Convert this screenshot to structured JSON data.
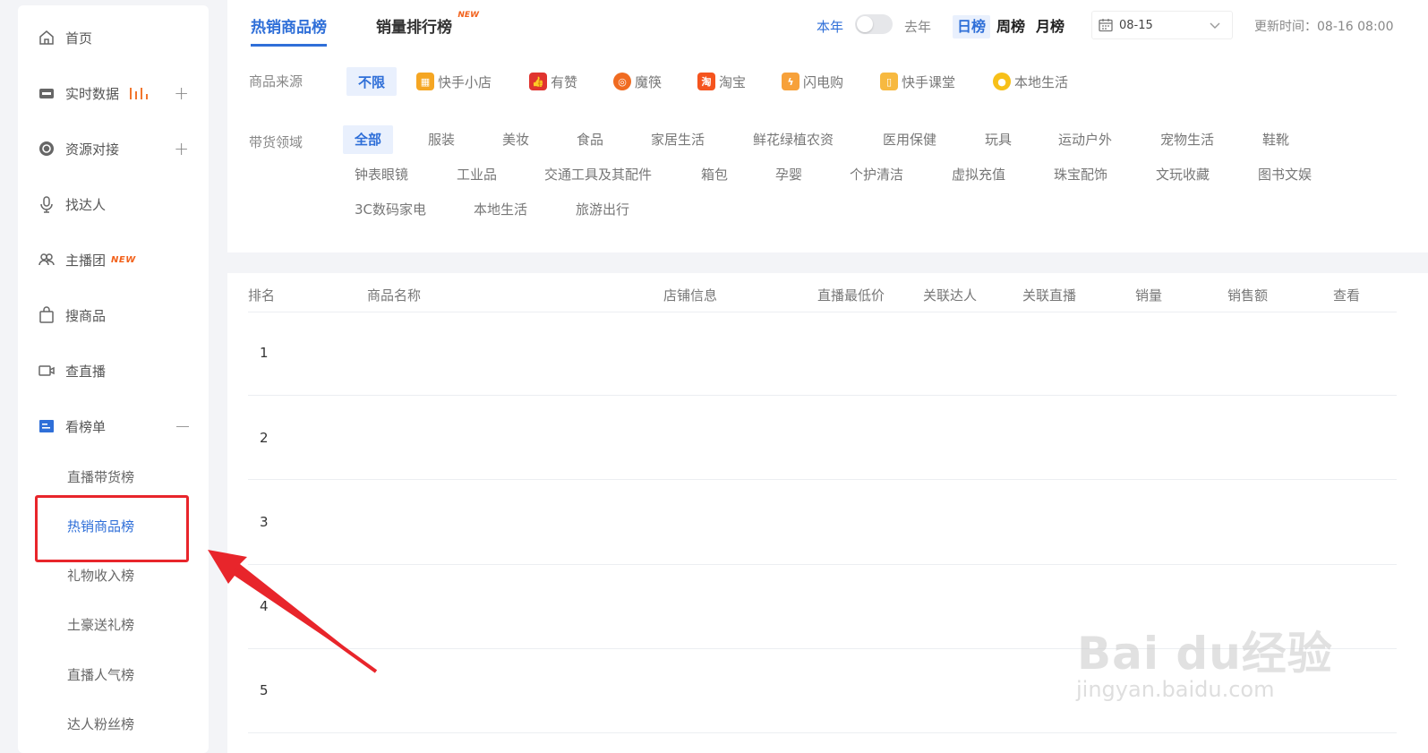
{
  "sidebar": {
    "items": [
      {
        "label": "首页"
      },
      {
        "label": "实时数据"
      },
      {
        "label": "资源对接"
      },
      {
        "label": "找达人"
      },
      {
        "label": "主播团",
        "badge": "NEW"
      },
      {
        "label": "搜商品"
      },
      {
        "label": "查直播"
      },
      {
        "label": "看榜单"
      }
    ],
    "sub_items": [
      {
        "label": "直播带货榜"
      },
      {
        "label": "热销商品榜"
      },
      {
        "label": "礼物收入榜"
      },
      {
        "label": "土豪送礼榜"
      },
      {
        "label": "直播人气榜"
      },
      {
        "label": "达人粉丝榜"
      }
    ]
  },
  "header": {
    "tabs": [
      {
        "label": "热销商品榜"
      },
      {
        "label": "销量排行榜",
        "badge": "NEW"
      }
    ],
    "year_this": "本年",
    "year_last": "去年",
    "periods": [
      "日榜",
      "周榜",
      "月榜"
    ],
    "date": "08-15",
    "update_time": "更新时间：08-16 08:00"
  },
  "filters": {
    "source_label": "商品来源",
    "sources": [
      {
        "label": "不限",
        "color": ""
      },
      {
        "label": "快手小店",
        "color": "#f5a623",
        "icon": "shop-icon"
      },
      {
        "label": "有赞",
        "color": "#e0342f",
        "icon": "thumb-icon"
      },
      {
        "label": "魔筷",
        "color": "#f06b21",
        "icon": "mokuai-icon"
      },
      {
        "label": "淘宝",
        "color": "#f5541e",
        "icon": "taobao-icon"
      },
      {
        "label": "闪电购",
        "color": "#f7a13a",
        "icon": "lightning-icon"
      },
      {
        "label": "快手课堂",
        "color": "#f7b940",
        "icon": "class-icon"
      },
      {
        "label": "本地生活",
        "color": "#f7c019",
        "icon": "location-icon"
      }
    ],
    "category_label": "带货领域",
    "categories": [
      "全部",
      "服装",
      "美妆",
      "食品",
      "家居生活",
      "鲜花绿植农资",
      "医用保健",
      "玩具",
      "运动户外",
      "宠物生活",
      "鞋靴",
      "钟表眼镜",
      "工业品",
      "交通工具及其配件",
      "箱包",
      "孕婴",
      "个护清洁",
      "虚拟充值",
      "珠宝配饰",
      "文玩收藏",
      "图书文娱",
      "3C数码家电",
      "本地生活",
      "旅游出行"
    ]
  },
  "table": {
    "columns": [
      "排名",
      "商品名称",
      "店铺信息",
      "直播最低价",
      "关联达人",
      "关联直播",
      "销量",
      "销售额",
      "查看"
    ],
    "ranks": [
      "1",
      "2",
      "3",
      "4",
      "5"
    ]
  },
  "watermark": {
    "line1": "Bai du经验",
    "line2": "jingyan.baidu.com"
  }
}
